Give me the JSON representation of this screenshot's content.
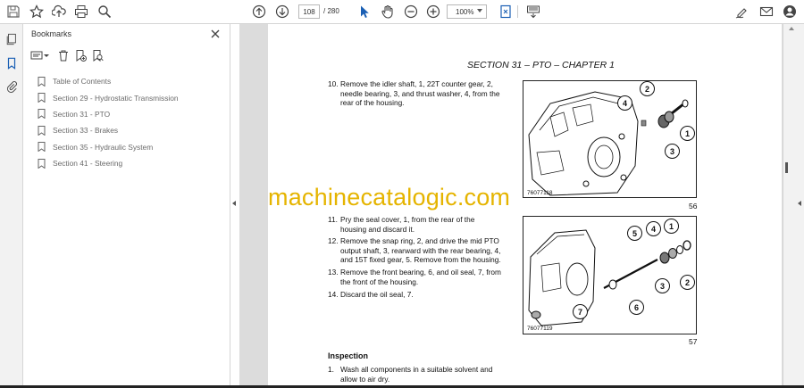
{
  "toolbar": {
    "page_current": "108",
    "page_total": "/ 280",
    "zoom": "100%",
    "icons": [
      "save-icon",
      "star-icon",
      "upload-icon",
      "print-icon",
      "search-icon",
      "scroll-up-icon",
      "scroll-down-icon",
      "select-cursor-icon",
      "hand-icon",
      "zoom-out-icon",
      "zoom-in-icon",
      "fit-page-icon",
      "keyboard-icon",
      "sign-icon",
      "email-icon",
      "account-icon"
    ]
  },
  "leftrail": {
    "icons": [
      "pages-icon",
      "bookmark-icon",
      "attachment-icon"
    ]
  },
  "bookmarks": {
    "title": "Bookmarks",
    "items": [
      {
        "label": "Table of Contents"
      },
      {
        "label": "Section 29 - Hydrostatic Transmission"
      },
      {
        "label": "Section 31 - PTO"
      },
      {
        "label": "Section 33 - Brakes"
      },
      {
        "label": "Section 35 - Hydraulic System"
      },
      {
        "label": "Section 41 - Steering"
      }
    ]
  },
  "document": {
    "header": "SECTION 31 – PTO – CHAPTER 1",
    "steps": [
      {
        "num": "10.",
        "text": "Remove the idler shaft, 1, 22T counter gear, 2, needle bearing, 3, and thrust washer, 4, from the rear of the housing."
      },
      {
        "num": "11.",
        "text": "Pry the seal cover, 1, from the rear of the housing and discard it."
      },
      {
        "num": "12.",
        "text": "Remove the snap ring, 2, and drive the mid PTO output shaft, 3, rearward with the rear bearing, 4, and 15T fixed gear, 5. Remove from the housing."
      },
      {
        "num": "13.",
        "text": "Remove the front bearing, 6, and oil seal, 7, from the front of the housing."
      },
      {
        "num": "14.",
        "text": "Discard the oil seal, 7."
      },
      {
        "num": "1.",
        "text": "Wash all components in a suitable solvent and allow to air dry."
      }
    ],
    "inspection": "Inspection",
    "figures": [
      {
        "id": "76077118",
        "number": "56",
        "callouts": [
          "1",
          "2",
          "3",
          "4"
        ]
      },
      {
        "id": "76077119",
        "number": "57",
        "callouts": [
          "1",
          "2",
          "3",
          "4",
          "5",
          "6",
          "7"
        ]
      }
    ]
  },
  "watermark": "machinecatalogic.com"
}
